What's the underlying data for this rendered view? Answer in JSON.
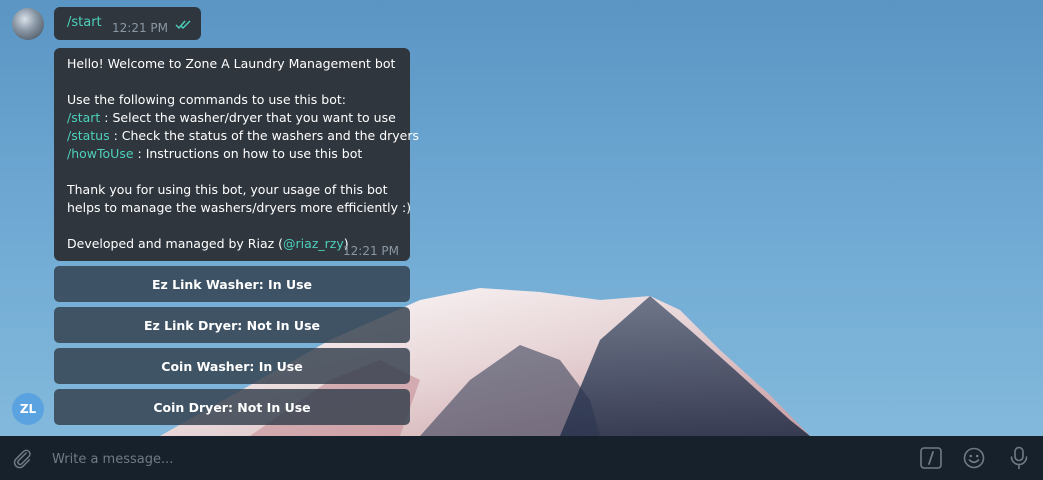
{
  "chat": {
    "outgoing": {
      "text": "/start",
      "time": "12:21 PM"
    },
    "bot_avatar_initials": "ZL",
    "incoming": {
      "time": "12:21 PM",
      "greeting": "Hello! Welcome to Zone A Laundry Management bot",
      "intro": "Use the following commands to use this bot:",
      "commands": [
        {
          "cmd": "/start",
          "desc": " : Select the washer/dryer that you want to use"
        },
        {
          "cmd": "/status",
          "desc": " : Check the status of the washers and the dryers"
        },
        {
          "cmd": "/howToUse",
          "desc": " : Instructions on how to use this bot"
        }
      ],
      "thanks_line1": "Thank you for using this bot, your usage of this bot",
      "thanks_line2": "helps to manage the washers/dryers more efficiently :)",
      "dev_prefix": "Developed and managed by Riaz (",
      "dev_handle": "@riaz_rzy",
      "dev_suffix": ")"
    },
    "keyboard": [
      {
        "label": "Ez Link Washer: In Use"
      },
      {
        "label": "Ez Link Dryer: Not In Use"
      },
      {
        "label": "Coin Washer: In Use"
      },
      {
        "label": "Coin Dryer: Not In Use"
      }
    ]
  },
  "input_bar": {
    "placeholder": "Write a message...",
    "icons": [
      "attach-icon",
      "bot-command-icon",
      "emoji-icon",
      "microphone-icon"
    ]
  },
  "colors": {
    "command_accent": "#4dd0bb",
    "bubble": "#2f363e",
    "input_bar": "#17212b",
    "bot_avatar": "#5aa3e0"
  }
}
